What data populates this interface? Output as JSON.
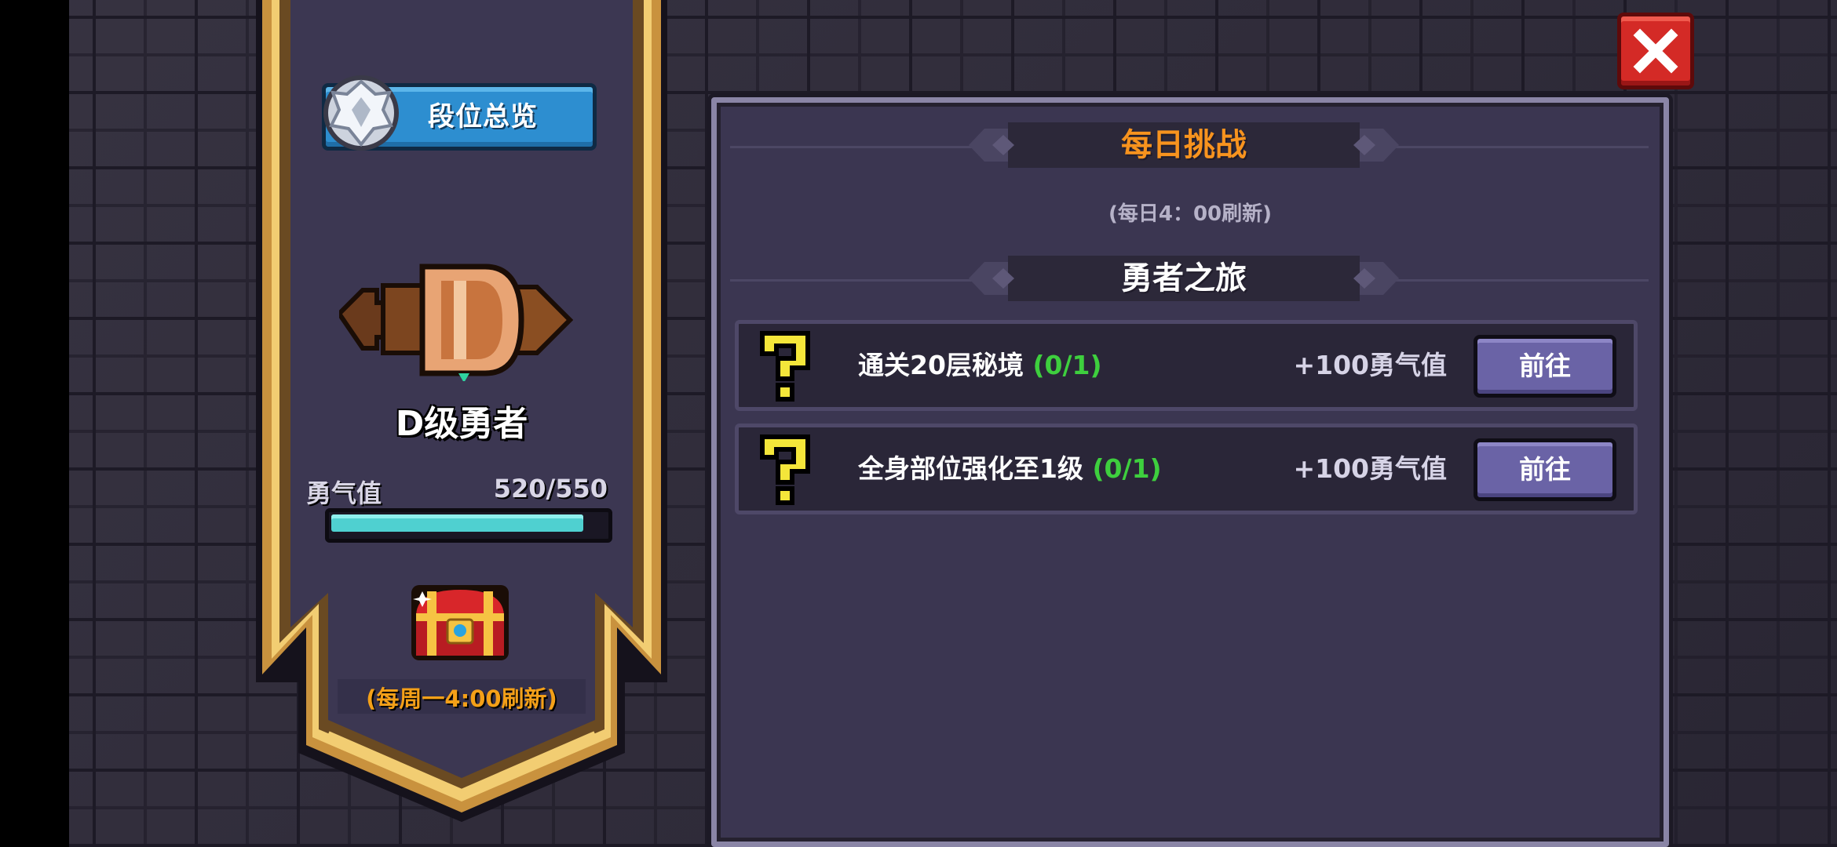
{
  "rank_overview": {
    "label": "段位总览",
    "emblem_icon": "silver-rank-emblem-icon"
  },
  "rank": {
    "title": "D级勇者",
    "badge_icon": "d-rank-badge-icon",
    "courage_label": "勇气值",
    "courage_value": "520/550",
    "courage_fraction": 0.945
  },
  "weekly": {
    "chest_icon": "treasure-chest-icon",
    "refresh_text": "(每周一4:00刷新)"
  },
  "daily": {
    "header": "每日挑战",
    "refresh_text": "(每日4：00刷新)",
    "section_title": "勇者之旅",
    "tasks": [
      {
        "name": "通关20层秘境",
        "progress": "(0/1)",
        "reward": "+100勇气值",
        "button": "前往",
        "icon": "question-mark-icon"
      },
      {
        "name": "全身部位强化至1级",
        "progress": "(0/1)",
        "reward": "+100勇气值",
        "button": "前往",
        "icon": "question-mark-icon"
      }
    ]
  },
  "close_icon": "close-icon",
  "colors": {
    "accent_orange": "#f7931e",
    "progress_green": "#3ecf3e",
    "bar_cyan": "#4fd0d0",
    "button_purple": "#6a63a6",
    "close_red": "#d42a26",
    "banner_gold": "#d8a64a"
  }
}
